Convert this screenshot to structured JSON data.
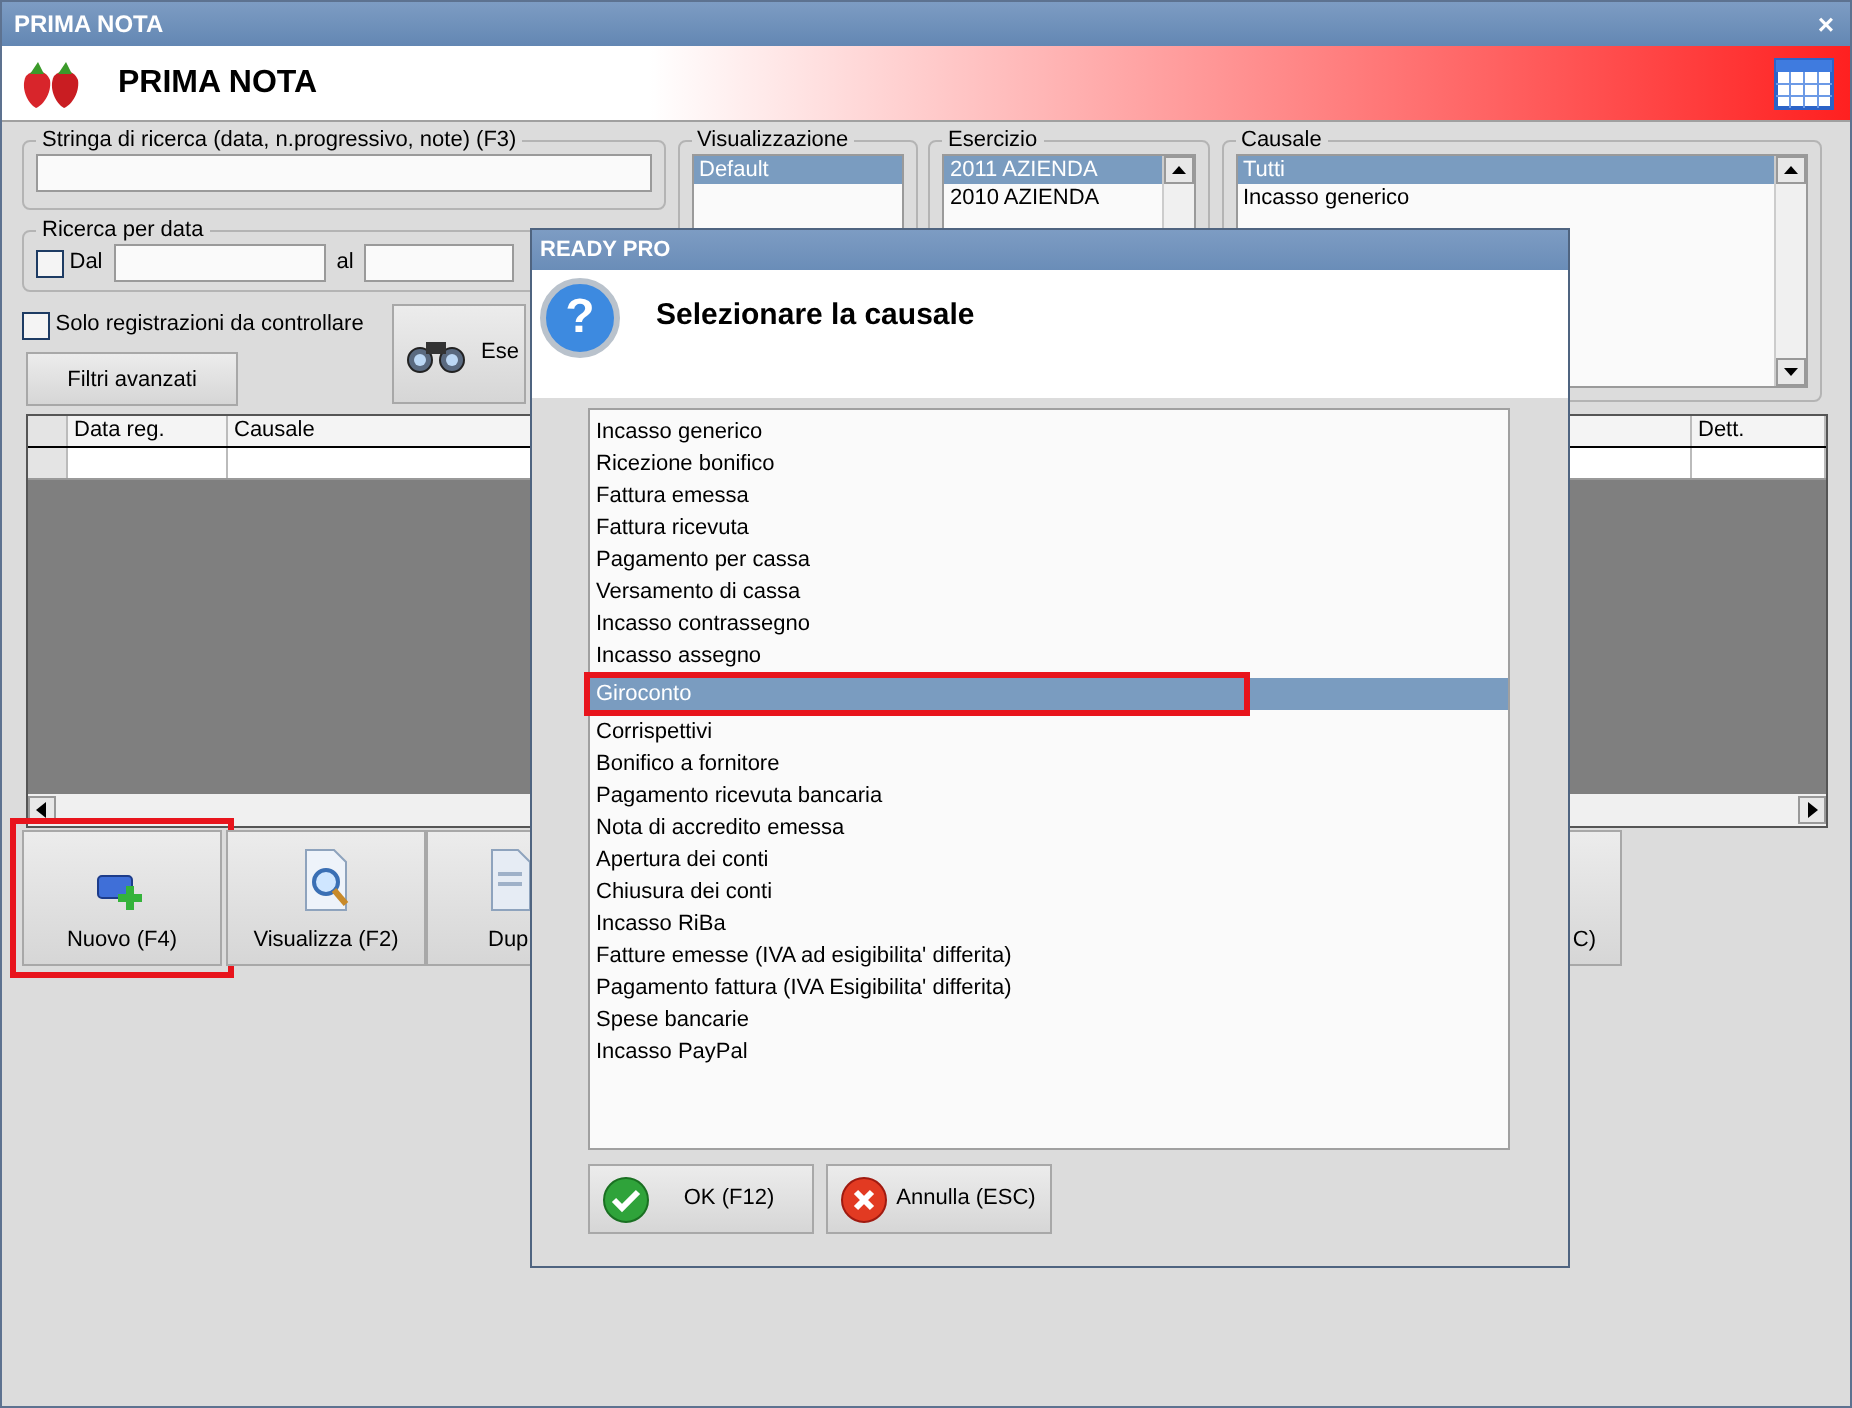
{
  "window": {
    "title": "PRIMA NOTA",
    "close_label": "×"
  },
  "header": {
    "title": "PRIMA NOTA"
  },
  "search": {
    "legend": "Stringa di ricerca (data, n.progressivo, note) (F3)"
  },
  "date_filter": {
    "legend": "Ricerca per data",
    "from_label": "Dal",
    "to_label": "al",
    "checked": false
  },
  "only_to_check": {
    "label": "Solo registrazioni da controllare",
    "checked": false
  },
  "advanced_button": "Filtri avanzati",
  "execute_button": "Ese",
  "view": {
    "legend": "Visualizzazione",
    "items": [
      {
        "label": "Default",
        "selected": true
      }
    ]
  },
  "year": {
    "legend": "Esercizio",
    "items": [
      {
        "label": "2011 AZIENDA",
        "selected": true
      },
      {
        "label": "2010 AZIENDA",
        "selected": false
      }
    ]
  },
  "causale": {
    "legend": "Causale",
    "items": [
      {
        "label": "Tutti",
        "selected": true
      },
      {
        "label": "Incasso generico",
        "selected": false
      }
    ]
  },
  "table": {
    "columns": [
      "Data reg.",
      "Causale",
      "Dett."
    ]
  },
  "actions": [
    {
      "label": "Nuovo (F4)",
      "kind": "new",
      "highlighted": true
    },
    {
      "label": "Visualizza (F2)",
      "kind": "view",
      "highlighted": false
    },
    {
      "label": "Dup",
      "kind": "copy",
      "highlighted": false
    },
    {
      "label": "C)",
      "kind": "hidden",
      "highlighted": false
    }
  ],
  "dialog": {
    "title": "READY PRO",
    "icon_glyph": "?",
    "message": "Selezionare la causale",
    "items": [
      {
        "label": "Incasso generico",
        "selected": false,
        "highlighted": false
      },
      {
        "label": "Ricezione bonifico",
        "selected": false,
        "highlighted": false
      },
      {
        "label": "Fattura emessa",
        "selected": false,
        "highlighted": false
      },
      {
        "label": "Fattura ricevuta",
        "selected": false,
        "highlighted": false
      },
      {
        "label": "Pagamento per cassa",
        "selected": false,
        "highlighted": false
      },
      {
        "label": "Versamento di cassa",
        "selected": false,
        "highlighted": false
      },
      {
        "label": "Incasso contrassegno",
        "selected": false,
        "highlighted": false
      },
      {
        "label": "Incasso assegno",
        "selected": false,
        "highlighted": false
      },
      {
        "label": "Giroconto",
        "selected": true,
        "highlighted": true
      },
      {
        "label": "Corrispettivi",
        "selected": false,
        "highlighted": false
      },
      {
        "label": "Bonifico a fornitore",
        "selected": false,
        "highlighted": false
      },
      {
        "label": "Pagamento ricevuta bancaria",
        "selected": false,
        "highlighted": false
      },
      {
        "label": "Nota di accredito emessa",
        "selected": false,
        "highlighted": false
      },
      {
        "label": "Apertura dei conti",
        "selected": false,
        "highlighted": false
      },
      {
        "label": "Chiusura dei conti",
        "selected": false,
        "highlighted": false
      },
      {
        "label": "Incasso RiBa",
        "selected": false,
        "highlighted": false
      },
      {
        "label": "Fatture emesse (IVA ad esigibilita' differita)",
        "selected": false,
        "highlighted": false
      },
      {
        "label": "Pagamento fattura (IVA Esigibilita' differita)",
        "selected": false,
        "highlighted": false
      },
      {
        "label": "Spese bancarie",
        "selected": false,
        "highlighted": false
      },
      {
        "label": "Incasso PayPal",
        "selected": false,
        "highlighted": false
      }
    ],
    "buttons": [
      {
        "label": "OK (F12)",
        "kind": "ok"
      },
      {
        "label": "Annulla (ESC)",
        "kind": "cancel"
      }
    ]
  }
}
